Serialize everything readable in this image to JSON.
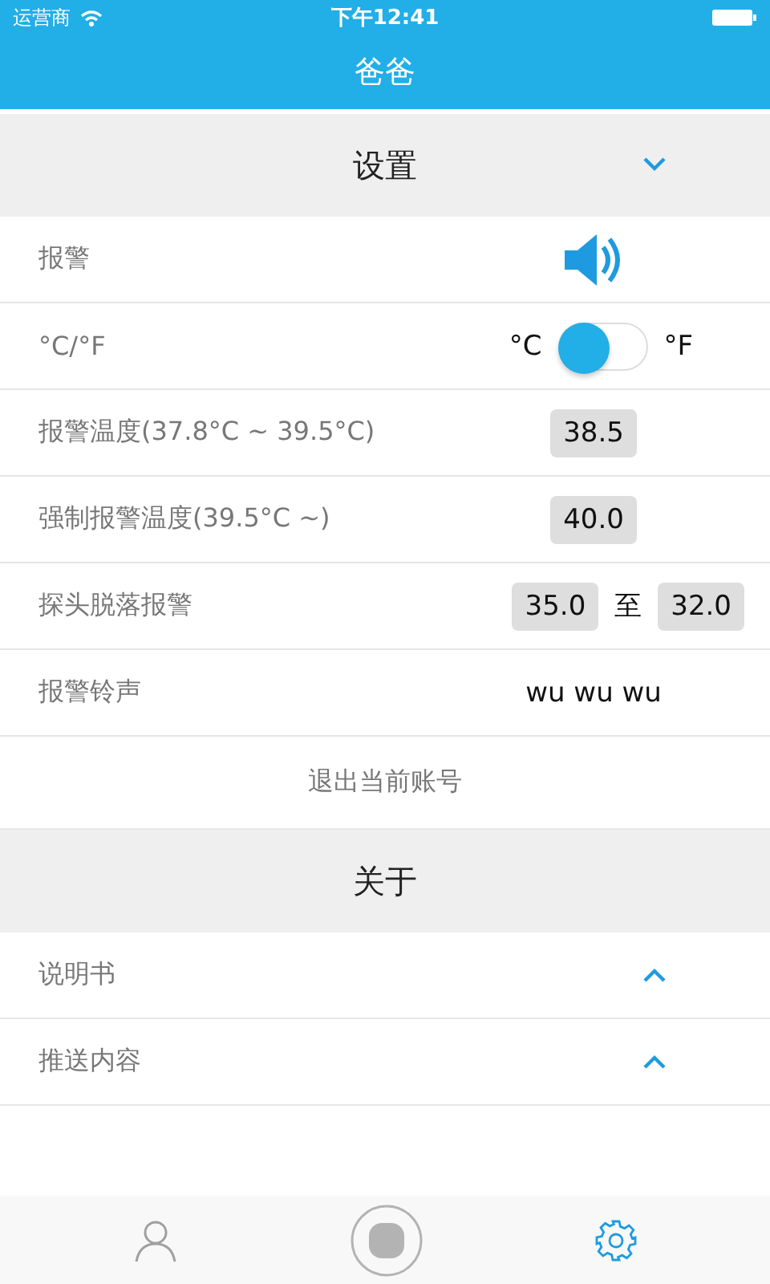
{
  "status_bar": {
    "carrier": "运营商",
    "time": "下午12:41"
  },
  "nav": {
    "title": "爸爸"
  },
  "sections": [
    {
      "title": "设置",
      "expanded": true,
      "rows": [
        {
          "kind": "sound",
          "label": "报警",
          "on": true
        },
        {
          "kind": "toggle",
          "label": "°C/°F",
          "left": "°C",
          "right": "°F",
          "on": false
        },
        {
          "kind": "value",
          "label": "报警温度(37.8°C ~ 39.5°C)",
          "value": "38.5"
        },
        {
          "kind": "value",
          "label": "强制报警温度(39.5°C ~)",
          "value": "40.0"
        },
        {
          "kind": "range",
          "label": "探头脱落报警",
          "from": "35.0",
          "joiner": "至",
          "to": "32.0"
        },
        {
          "kind": "text",
          "label": "报警铃声",
          "value": "wu wu wu"
        },
        {
          "kind": "action",
          "label": "退出当前账号"
        }
      ]
    },
    {
      "title": "关于",
      "rows": [
        {
          "kind": "expand",
          "label": "说明书",
          "expanded": false
        },
        {
          "kind": "expand",
          "label": "推送内容",
          "expanded": false
        }
      ]
    }
  ],
  "tab_bar": [
    {
      "kind": "person",
      "selected": false
    },
    {
      "kind": "record",
      "selected": false
    },
    {
      "kind": "gear",
      "selected": true
    }
  ]
}
